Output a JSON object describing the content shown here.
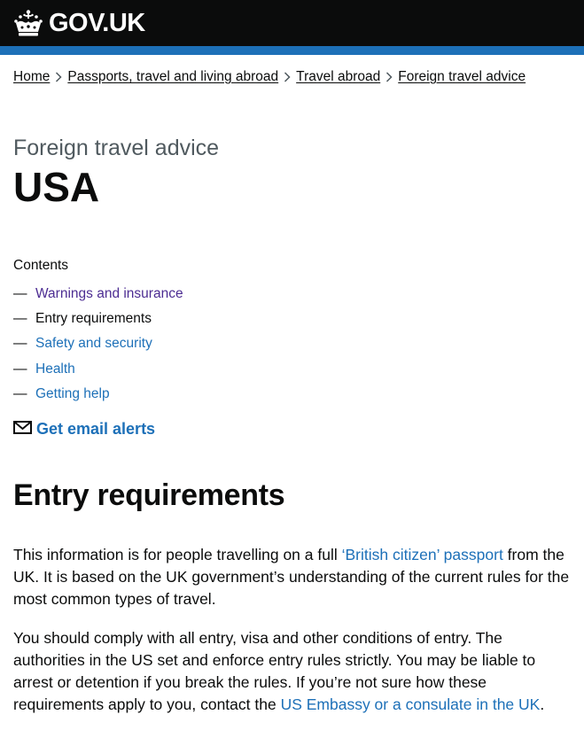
{
  "header": {
    "logo_text": "GOV.UK"
  },
  "breadcrumbs": [
    {
      "label": "Home"
    },
    {
      "label": "Passports, travel and living abroad"
    },
    {
      "label": "Travel abroad"
    },
    {
      "label": "Foreign travel advice"
    }
  ],
  "page": {
    "caption": "Foreign travel advice",
    "title": "USA"
  },
  "contents": {
    "label": "Contents",
    "items": [
      {
        "dash": "—",
        "label": "Warnings and insurance",
        "state": "visited"
      },
      {
        "dash": "—",
        "label": "Entry requirements",
        "state": "current"
      },
      {
        "dash": "—",
        "label": "Safety and security",
        "state": "link"
      },
      {
        "dash": "—",
        "label": "Health",
        "state": "link"
      },
      {
        "dash": "—",
        "label": "Getting help",
        "state": "link"
      }
    ]
  },
  "email_alerts": {
    "label": "Get email alerts"
  },
  "section": {
    "heading": "Entry requirements",
    "p1": {
      "before": "This information is for people travelling on a full ",
      "link": "‘British citizen’ passport",
      "after": " from the UK. It is based on the UK government’s understanding of the current rules for the most common types of travel."
    },
    "p2": {
      "before": "You should comply with all entry, visa and other conditions of entry. The authorities in the US set and enforce entry rules strictly. You may be liable to arrest or detention if you break the rules. If you’re not sure how these requirements apply to you, contact the ",
      "link": "US Embassy or a consulate in the UK",
      "after": "."
    }
  },
  "colors": {
    "header_bg": "#0b0c0c",
    "header_bar": "#1d70b8",
    "link": "#1d70b8",
    "visited_link": "#4c2c92",
    "text": "#0b0c0c",
    "secondary_text": "#505a5f"
  },
  "icons": {
    "logo": "crown-icon",
    "breadcrumb_separator": "chevron-right-icon",
    "email": "envelope-icon"
  }
}
